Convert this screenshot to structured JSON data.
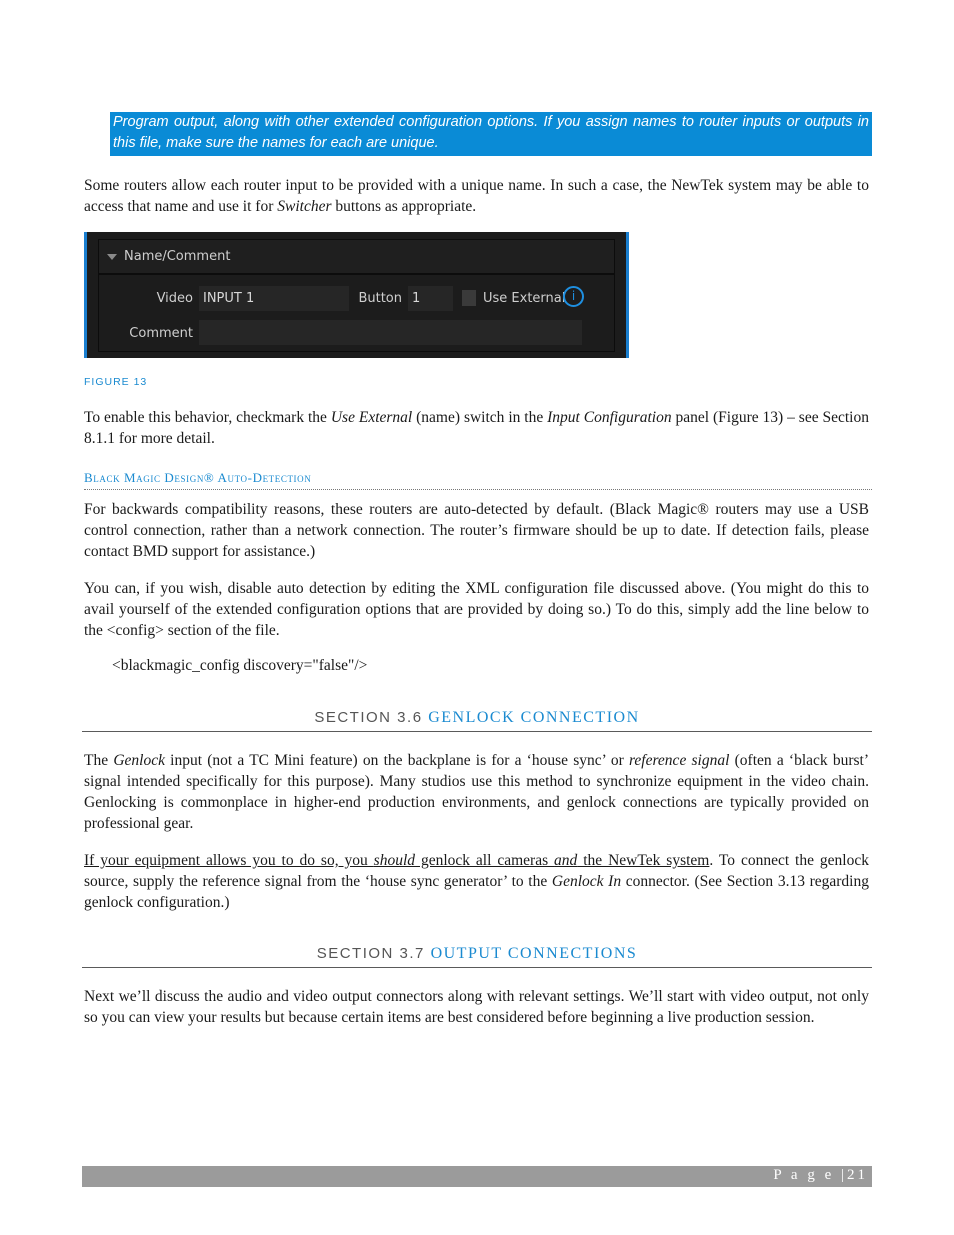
{
  "callout": {
    "text": "Program output, along with other extended configuration options. If you assign names to router inputs or outputs in this file, make sure the names for each are unique."
  },
  "para1": {
    "a": "Some routers allow each router input to be provided with a unique name.  In such a case, the NewTek system may be able to access that name and use it for ",
    "em": "Switcher",
    "b": " buttons as appropriate."
  },
  "figure": {
    "header": "Name/Comment",
    "video_label": "Video",
    "video_value": "INPUT 1",
    "button_label": "Button",
    "button_value": "1",
    "use_external_label": "Use External",
    "use_external_checked": false,
    "info_glyph": "i",
    "comment_label": "Comment",
    "comment_value": "",
    "caption": "FIGURE 13"
  },
  "para2": {
    "a": "To enable this behavior, checkmark the ",
    "em1": "Use External",
    "b": " (name) switch in the ",
    "em2": "Input Configuration",
    "c": " panel (Figure 13) – see Section 8.1.1 for more detail."
  },
  "subhead": "Black Magic Design® Auto-Detection",
  "para3": "For backwards compatibility reasons, these routers are auto-detected by default.  (Black Magic® routers may use a USB control connection, rather than a network connection. The router’s firmware should be up to date. If detection fails, please contact BMD support for assistance.)",
  "para4": "You can, if you wish, disable auto detection by editing the XML configuration file discussed above.  (You might do this to avail yourself of the extended configuration options that are provided by doing so.)  To do this, simply add the line below to the <config> section of the file.",
  "code_line": "<blackmagic_config discovery=\"false\"/>",
  "section36": {
    "num": "SECTION 3.6 ",
    "title": "GENLOCK CONNECTION"
  },
  "para5": {
    "a": "The ",
    "em1": "Genlock",
    "b": " input (not a TC Mini feature) on the backplane is for a ‘house sync’ or ",
    "em2": "reference signal",
    "c": " (often a ‘black burst’ signal intended specifically for this purpose).  Many studios use this method to synchronize equipment in the video chain. Genlocking is commonplace in higher-end production environments, and genlock connections are typically provided on professional gear."
  },
  "para6": {
    "u1": "If your equipment allows you to do so, you ",
    "u_em1": "should",
    "u2": " genlock all cameras ",
    "u_em2": "and",
    "u3": " the NewTek system",
    "a": ".  To connect the genlock source, supply the reference signal from the ‘house sync generator’ to the ",
    "em": "Genlock In",
    "b": " connector. (See Section 3.13 regarding genlock configuration.)"
  },
  "section37": {
    "num": "SECTION 3.7 ",
    "title": "OUTPUT CONNECTIONS"
  },
  "para7": "Next we’ll discuss the audio and video output connectors along with relevant settings. We’ll start with video output, not only so you can view your results but because certain items are best considered before beginning a live production session.",
  "footer": {
    "page_label": "P a g e  |",
    "page_number": "21"
  }
}
